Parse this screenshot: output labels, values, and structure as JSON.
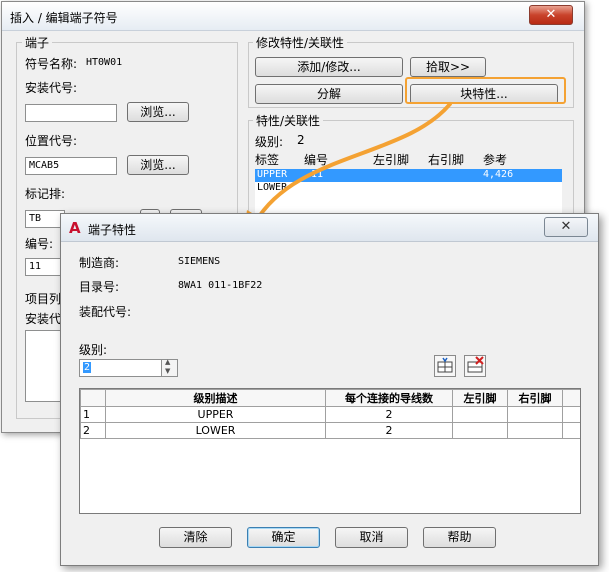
{
  "back_dialog": {
    "title": "插入 / 编辑端子符号",
    "close_glyph": "✕",
    "terminal_group": {
      "label": "端子",
      "symbol_name_label": "符号名称:",
      "symbol_name_value": "HT0W01",
      "install_code_label": "安装代号:",
      "install_code_value": "",
      "browse1": "浏览...",
      "location_code_label": "位置代号:",
      "location_code_value": "MCAB5",
      "browse2": "浏览...",
      "tag_strip_label": "标记排:",
      "tag_strip_value": "TB",
      "number_label": "编号:",
      "number_value": "11",
      "project_list_label": "项目列",
      "install_code2_label": "安装代"
    },
    "modify_group": {
      "label": "修改特性/关联性",
      "add_modify": "添加/修改...",
      "pick": "拾取>>",
      "explode": "分解",
      "block_props": "块特性..."
    },
    "props_group": {
      "label": "特性/关联性",
      "level_label": "级别:",
      "level_value": "2",
      "columns": [
        "标签",
        "编号",
        "左引脚",
        "右引脚",
        "参考"
      ],
      "rows": [
        {
          "tag": "UPPER",
          "number": "11",
          "left": "",
          "right": "",
          "ref": "4,426"
        },
        {
          "tag": "LOWER",
          "number": "",
          "left": "",
          "right": "",
          "ref": ""
        }
      ]
    }
  },
  "front_dialog": {
    "title": "端子特性",
    "close_glyph": "✕",
    "manufacturer_label": "制造商:",
    "manufacturer_value": "SIEMENS",
    "catalog_label": "目录号:",
    "catalog_value": "8WA1 011-1BF22",
    "assembly_label": "装配代号:",
    "assembly_value": "",
    "level_label": "级别:",
    "level_value": "2",
    "table": {
      "columns": [
        "级别描述",
        "每个连接的导线数",
        "左引脚",
        "右引脚"
      ],
      "rows": [
        {
          "idx": "1",
          "desc": "UPPER",
          "wires": "2",
          "left": "",
          "right": ""
        },
        {
          "idx": "2",
          "desc": "LOWER",
          "wires": "2",
          "left": "",
          "right": ""
        }
      ]
    },
    "buttons": {
      "clear": "清除",
      "ok": "确定",
      "cancel": "取消",
      "help": "帮助"
    }
  },
  "colors": {
    "highlight": "#f4a233",
    "selection": "#3399ff",
    "acad_red": "#c8102e"
  }
}
